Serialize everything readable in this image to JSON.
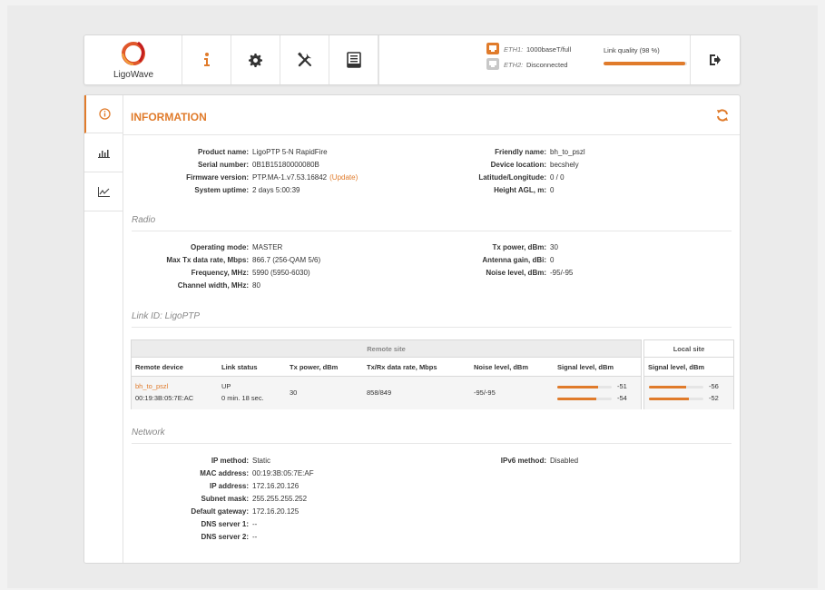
{
  "header": {
    "logo_text": "LigoWave",
    "eth1": {
      "name": "ETH1:",
      "value": "1000baseT/full"
    },
    "eth2": {
      "name": "ETH2:",
      "value": "Disconnected"
    },
    "link_quality": {
      "label": "Link quality (98 %)",
      "value": 0.98
    },
    "nav_icons": [
      "info-icon",
      "gear-icon",
      "tools-icon",
      "archive-icon"
    ]
  },
  "sidebar": [
    "info-icon",
    "bar-chart-icon",
    "line-chart-icon"
  ],
  "page": {
    "title": "INFORMATION"
  },
  "information": {
    "left": [
      {
        "k": "Product name:",
        "v": "LigoPTP 5-N RapidFire"
      },
      {
        "k": "Serial number:",
        "v": "0B1B15180000080B"
      },
      {
        "k": "Firmware version:",
        "v": "PTP.MA-1.v7.53.16842",
        "link": "(Update)"
      },
      {
        "k": "System uptime:",
        "v": "2 days 5:00:39"
      }
    ],
    "right": [
      {
        "k": "Friendly name:",
        "v": "bh_to_pszl"
      },
      {
        "k": "Device location:",
        "v": "becshely"
      },
      {
        "k": "Latitude/Longitude:",
        "v": "0 / 0"
      },
      {
        "k": "Height AGL, m:",
        "v": "0"
      }
    ]
  },
  "radio": {
    "title": "Radio",
    "left": [
      {
        "k": "Operating mode:",
        "v": "MASTER"
      },
      {
        "k": "Max Tx data rate, Mbps:",
        "v": "866.7 (256-QAM 5/6)"
      },
      {
        "k": "Frequency, MHz:",
        "v": "5990 (5950-6030)"
      },
      {
        "k": "Channel width, MHz:",
        "v": "80"
      }
    ],
    "right": [
      {
        "k": "Tx power, dBm:",
        "v": "30"
      },
      {
        "k": "Antenna gain, dBi:",
        "v": "0"
      },
      {
        "k": "Noise level, dBm:",
        "v": "-95/-95"
      }
    ]
  },
  "link": {
    "title": "Link ID: LigoPTP",
    "remote_site_label": "Remote site",
    "local_site_label": "Local site",
    "columns": [
      "Remote device",
      "Link status",
      "Tx power, dBm",
      "Tx/Rx data rate, Mbps",
      "Noise level, dBm",
      "Signal level, dBm"
    ],
    "local_column": "Signal level, dBm",
    "row": {
      "device_name": "bh_to_pszl",
      "device_mac": "00:19:3B:05:7E:AC",
      "status": "UP",
      "status_time": "0 min. 18 sec.",
      "tx_power": "30",
      "data_rate": "858/849",
      "noise": "-95/-95",
      "remote_signal": [
        {
          "value": "-51",
          "fill": 0.75
        },
        {
          "value": "-54",
          "fill": 0.72
        }
      ],
      "local_signal": [
        {
          "value": "-56",
          "fill": 0.68
        },
        {
          "value": "-52",
          "fill": 0.73
        }
      ]
    }
  },
  "network": {
    "title": "Network",
    "left": [
      {
        "k": "IP method:",
        "v": "Static"
      },
      {
        "k": "MAC address:",
        "v": "00:19:3B:05:7E:AF"
      },
      {
        "k": "IP address:",
        "v": "172.16.20.126"
      },
      {
        "k": "Subnet mask:",
        "v": "255.255.255.252"
      },
      {
        "k": "Default gateway:",
        "v": "172.16.20.125"
      },
      {
        "k": "DNS server 1:",
        "v": "--"
      },
      {
        "k": "DNS server 2:",
        "v": "--"
      }
    ],
    "right": [
      {
        "k": "IPv6 method:",
        "v": "Disabled"
      }
    ]
  },
  "colors": {
    "accent": "#e07b2b"
  }
}
